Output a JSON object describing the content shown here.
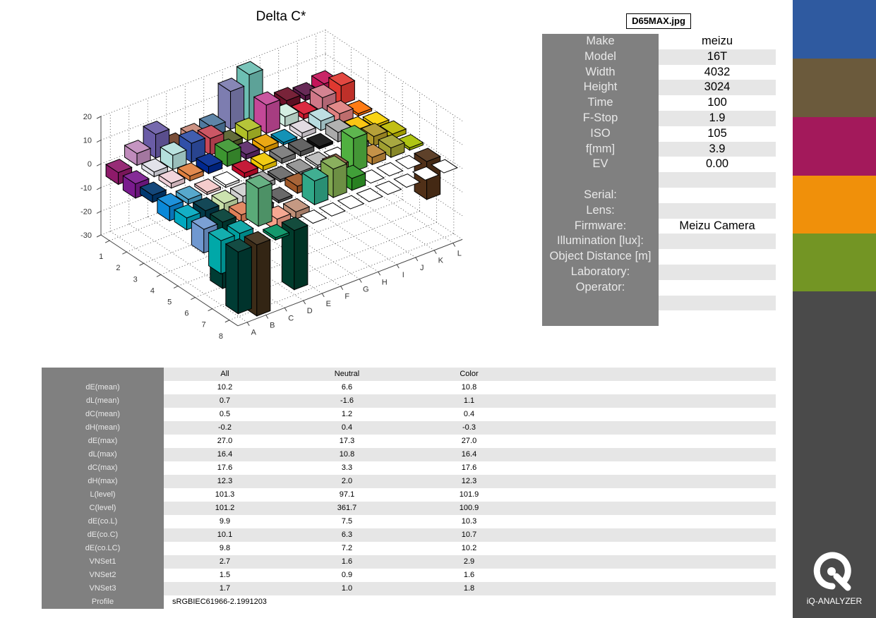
{
  "chart_data": {
    "type": "bar3d",
    "title": "Delta C*",
    "rows": [
      "1",
      "2",
      "3",
      "4",
      "5",
      "6",
      "7",
      "8"
    ],
    "columns": [
      "A",
      "B",
      "C",
      "D",
      "E",
      "F",
      "G",
      "H",
      "I",
      "J",
      "K",
      "L"
    ],
    "zlim": [
      -30,
      20
    ],
    "zticks": [
      20,
      10,
      0,
      -10,
      -20,
      -30
    ],
    "grid": true,
    "values": [
      [
        [
          -5,
          "#8e1a6a"
        ],
        [
          5,
          "#c08cbc"
        ],
        [
          10,
          "#6a5ca6"
        ],
        [
          2,
          "#6e4028"
        ],
        [
          3,
          "#c88878"
        ],
        [
          4,
          "#507aa0"
        ],
        [
          16,
          "#7d7db0"
        ],
        [
          20,
          "#6dbfb3"
        ],
        [
          2,
          "#f8d0b8"
        ],
        [
          3,
          "#6c1028"
        ],
        [
          2,
          "#5a1848"
        ],
        [
          4,
          "#c4145a"
        ]
      ],
      [
        [
          -6,
          "#7a1a8e"
        ],
        [
          2,
          "#e0e0e8"
        ],
        [
          6,
          "#b4e0dc"
        ],
        [
          8,
          "#3050a8"
        ],
        [
          7,
          "#c84858"
        ],
        [
          2,
          "#56602a"
        ],
        [
          4,
          "#b0c028"
        ],
        [
          12,
          "#c44898"
        ],
        [
          4,
          "#d0ece0"
        ],
        [
          2,
          "#d81830"
        ],
        [
          6,
          "#d07888"
        ],
        [
          8,
          "#e03830"
        ]
      ],
      [
        [
          -3,
          "#003870"
        ],
        [
          2,
          "#f0d0d8"
        ],
        [
          2,
          "#e08040"
        ],
        [
          3,
          "#002890"
        ],
        [
          6,
          "#3c9630"
        ],
        [
          2,
          "#5a2868"
        ],
        [
          2,
          "#e8a000"
        ],
        [
          1,
          "#0088b0"
        ],
        [
          2,
          "#e0d8e0"
        ],
        [
          4,
          "#b8dce0"
        ],
        [
          4,
          "#e08080"
        ],
        [
          1,
          "#ff7000"
        ]
      ],
      [
        [
          -6,
          "#0a88d8"
        ],
        [
          -2,
          "#48a0c8"
        ],
        [
          -1,
          "#f4c8c8"
        ],
        [
          -1,
          "#ffffff"
        ],
        [
          2,
          "#c00828"
        ],
        [
          2,
          "#f0c800"
        ],
        [
          2,
          "#787878"
        ],
        [
          2,
          "#585858"
        ],
        [
          1,
          "#101010"
        ],
        [
          4,
          "#aaaaaa"
        ],
        [
          2,
          "#f8c000"
        ],
        [
          1,
          "#f8d000"
        ]
      ],
      [
        [
          -5,
          "#00a8c0"
        ],
        [
          -8,
          "#003848"
        ],
        [
          -6,
          "#c8e0a8"
        ],
        [
          -4,
          "#d0d0d0"
        ],
        [
          2,
          "#a0a0a0"
        ],
        [
          1,
          "#686868"
        ],
        [
          1,
          "#909090"
        ],
        [
          1,
          "#bbbbbb"
        ],
        [
          0,
          "#ffffff"
        ],
        [
          3,
          "#6c6c6c"
        ],
        [
          4,
          "#b09828"
        ],
        [
          2,
          "#bcb800"
        ]
      ],
      [
        [
          -10,
          "#7098d0"
        ],
        [
          -28,
          "#003c34"
        ],
        [
          -3,
          "#e08058"
        ],
        [
          -2,
          "#484848"
        ],
        [
          -1,
          "#5c5c5c"
        ],
        [
          3,
          "#a05828"
        ],
        [
          2,
          "#b89068"
        ],
        [
          5,
          "#8a5a3c"
        ],
        [
          14,
          "#50b040"
        ],
        [
          3,
          "#c08838"
        ],
        [
          4,
          "#a0a030"
        ],
        [
          1,
          "#a8c000"
        ]
      ],
      [
        [
          -14,
          "#00a8a8"
        ],
        [
          -12,
          "#00a0a0"
        ],
        [
          16,
          "#5aaa78"
        ],
        [
          -5,
          "#f4a088"
        ],
        [
          -3,
          "#c09078"
        ],
        [
          10,
          "#30a888"
        ],
        [
          12,
          "#80a850"
        ],
        [
          5,
          "#309828"
        ],
        [
          0,
          "#ffffff"
        ],
        [
          0,
          "#ffffff"
        ],
        [
          0,
          "#ffffff"
        ],
        [
          -16,
          "#503018"
        ]
      ],
      [
        [
          -26,
          "#003c34"
        ],
        [
          -30,
          "#3c2c18"
        ],
        [
          -1,
          "#009060"
        ],
        [
          -25,
          "#003c2c"
        ],
        [
          0,
          "#ffffff"
        ],
        [
          0,
          "#ffffff"
        ],
        [
          0,
          "#ffffff"
        ],
        [
          0,
          "#ffffff"
        ],
        [
          0,
          "#ffffff"
        ],
        [
          0,
          "#ffffff"
        ],
        [
          0,
          "#ffffff"
        ],
        [
          0,
          "#ffffff"
        ]
      ]
    ]
  },
  "file_name": "D65MAX.jpg",
  "meta": [
    {
      "k": "Make",
      "v": "meizu"
    },
    {
      "k": "Model",
      "v": "16T"
    },
    {
      "k": "Width",
      "v": "4032"
    },
    {
      "k": "Height",
      "v": "3024"
    },
    {
      "k": "Time",
      "v": "100"
    },
    {
      "k": "F-Stop",
      "v": "1.9"
    },
    {
      "k": "ISO",
      "v": "105"
    },
    {
      "k": "f[mm]",
      "v": "3.9"
    },
    {
      "k": "EV",
      "v": "0.00"
    },
    {
      "k": "",
      "v": ""
    },
    {
      "k": "Serial:",
      "v": ""
    },
    {
      "k": "Lens:",
      "v": ""
    },
    {
      "k": "Firmware:",
      "v": "Meizu Camera"
    },
    {
      "k": "Illumination [lux]:",
      "v": ""
    },
    {
      "k": "Object Distance [m]",
      "v": ""
    },
    {
      "k": "Laboratory:",
      "v": ""
    },
    {
      "k": "Operator:",
      "v": ""
    },
    {
      "k": "",
      "v": ""
    }
  ],
  "results": {
    "headers": [
      "All",
      "Neutral",
      "Color"
    ],
    "rows": [
      {
        "k": "dE(mean)",
        "v": [
          "10.2",
          "6.6",
          "10.8"
        ]
      },
      {
        "k": "dL(mean)",
        "v": [
          "0.7",
          "-1.6",
          "1.1"
        ]
      },
      {
        "k": "dC(mean)",
        "v": [
          "0.5",
          "1.2",
          "0.4"
        ]
      },
      {
        "k": "dH(mean)",
        "v": [
          "-0.2",
          "0.4",
          "-0.3"
        ]
      },
      {
        "k": "dE(max)",
        "v": [
          "27.0",
          "17.3",
          "27.0"
        ]
      },
      {
        "k": "dL(max)",
        "v": [
          "16.4",
          "10.8",
          "16.4"
        ]
      },
      {
        "k": "dC(max)",
        "v": [
          "17.6",
          "3.3",
          "17.6"
        ]
      },
      {
        "k": "dH(max)",
        "v": [
          "12.3",
          "2.0",
          "12.3"
        ]
      },
      {
        "k": "L(level)",
        "v": [
          "101.3",
          "97.1",
          "101.9"
        ]
      },
      {
        "k": "C(level)",
        "v": [
          "101.2",
          "361.7",
          "100.9"
        ]
      },
      {
        "k": "dE(co.L)",
        "v": [
          "9.9",
          "7.5",
          "10.3"
        ]
      },
      {
        "k": "dE(co.C)",
        "v": [
          "10.1",
          "6.3",
          "10.7"
        ]
      },
      {
        "k": "dE(co.LC)",
        "v": [
          "9.8",
          "7.2",
          "10.2"
        ]
      },
      {
        "k": "VNSet1",
        "v": [
          "2.7",
          "1.6",
          "2.9"
        ]
      },
      {
        "k": "VNSet2",
        "v": [
          "1.5",
          "0.9",
          "1.6"
        ]
      },
      {
        "k": "VNSet3",
        "v": [
          "1.7",
          "1.0",
          "1.8"
        ]
      }
    ],
    "profile_label": "Profile",
    "profile_value": "sRGBIEC61966-2.1991203"
  },
  "sidebar_colors": [
    "#2f5aa0",
    "#6b5a3c",
    "#a3195b",
    "#f0900a",
    "#739524",
    "#4a4a4a"
  ],
  "logo_text": "iQ-ANALYZER",
  "logo_icon": "iq-analyzer-logo-icon"
}
